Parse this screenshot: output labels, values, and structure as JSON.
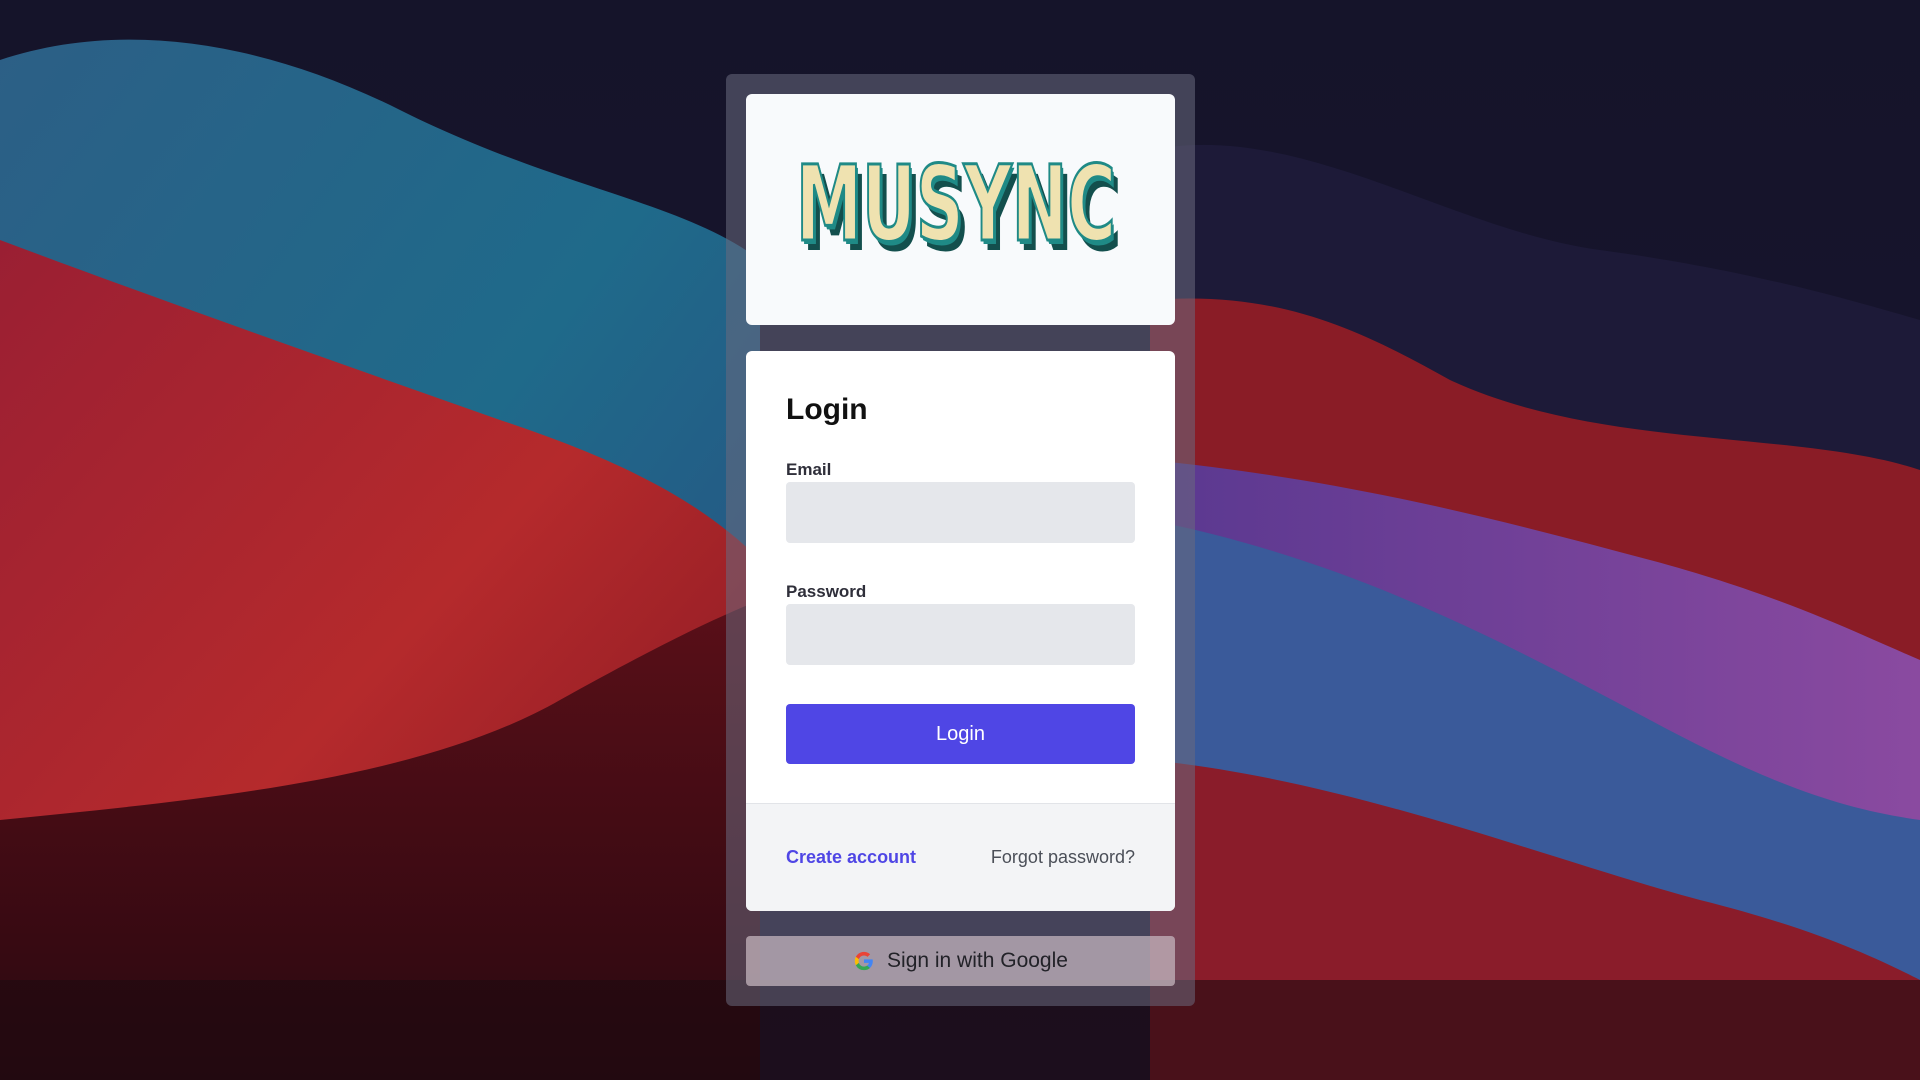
{
  "app": {
    "logo_text": "MUSYNC"
  },
  "login": {
    "title": "Login",
    "email_label": "Email",
    "email_value": "",
    "password_label": "Password",
    "password_value": "",
    "submit_label": "Login"
  },
  "footer": {
    "create_account_label": "Create account",
    "forgot_password_label": "Forgot password?"
  },
  "google": {
    "label": "Sign in with Google",
    "icon": "google-icon"
  },
  "colors": {
    "primary": "#4f46e5",
    "input_bg": "#e5e7eb",
    "card_bg": "#ffffff",
    "logo_teal": "#1f8a86",
    "logo_cream": "#efe2b0"
  }
}
